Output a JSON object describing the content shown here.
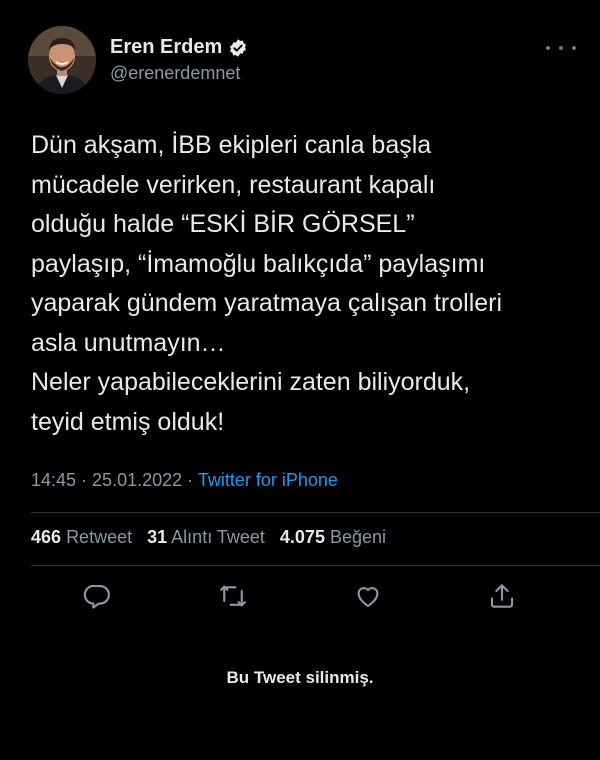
{
  "author": {
    "display_name": "Eren Erdem",
    "handle": "@erenerdemnet",
    "verified": true
  },
  "tweet": {
    "lines": [
      "Dün akşam, İBB ekipleri canla başla",
      "mücadele verirken, restaurant kapalı",
      "olduğu halde “ESKİ BİR GÖRSEL”",
      "paylaşıp, “İmamoğlu balıkçıda” paylaşımı",
      "yaparak gündem yaratmaya çalışan trolleri",
      "asla unutmayın…",
      "Neler yapabileceklerini zaten biliyorduk,",
      "teyid etmiş olduk!"
    ]
  },
  "meta": {
    "time": "14:45",
    "separator": " · ",
    "date": "25.01.2022",
    "source": "Twitter for iPhone"
  },
  "stats": {
    "retweets_count": "466",
    "retweets_label": "Retweet",
    "quotes_count": "31",
    "quotes_label": "Alıntı Tweet",
    "likes_count": "4.075",
    "likes_label": "Beğeni"
  },
  "actions": {
    "icons": [
      "reply-icon",
      "retweet-icon",
      "like-icon",
      "share-icon"
    ]
  },
  "notice": "Bu Tweet silinmiş.",
  "colors": {
    "background": "#000000",
    "text": "#e7e9ea",
    "secondary": "#8b98a5",
    "link": "#1d9bf0",
    "divider": "#2f3336"
  }
}
